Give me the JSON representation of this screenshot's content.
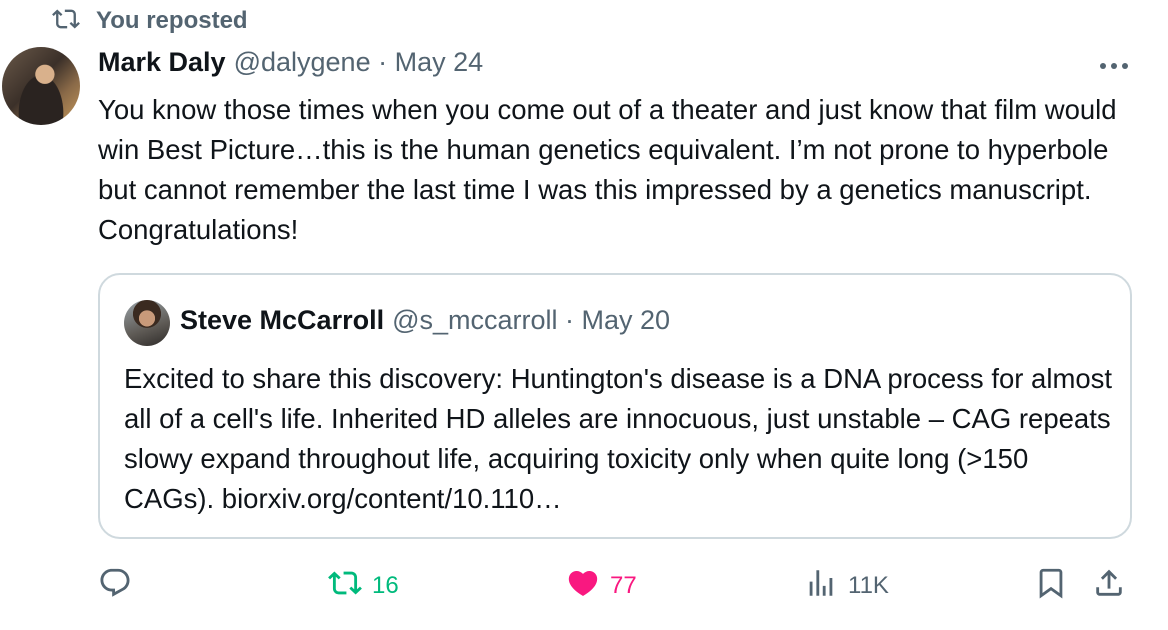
{
  "repost": {
    "label": "You reposted"
  },
  "post": {
    "author_name": "Mark Daly",
    "meta": "@dalygene · May 24",
    "text": "You know those times when you come out of a theater and just know that film would win Best Picture…this is the human genetics equivalent. I’m not prone to hyperbole but cannot remember the last time I was this impressed by a genetics manuscript. Congratulations!"
  },
  "quote": {
    "author_name": "Steve McCarroll",
    "meta": "@s_mccarroll · May 20",
    "text": "Excited to share this discovery:  Huntington's disease is a DNA process for almost all of a cell's life.   Inherited HD alleles are innocuous, just unstable – CAG repeats slowy expand throughout life, acquiring toxicity only when quite long (>150 CAGs).  biorxiv.org/content/10.110…"
  },
  "actions": {
    "retweets": "16",
    "likes": "77",
    "views": "11K"
  },
  "icons": {
    "repost": "repost-icon",
    "more": "more-icon",
    "reply": "reply-icon",
    "retweet": "retweet-icon",
    "like": "heart-icon",
    "views": "views-icon",
    "bookmark": "bookmark-icon",
    "share": "share-icon"
  },
  "colors": {
    "secondary_text": "#536471",
    "retweet_active": "#00ba7c",
    "like_active": "#f91880",
    "border": "#cfd9de"
  }
}
